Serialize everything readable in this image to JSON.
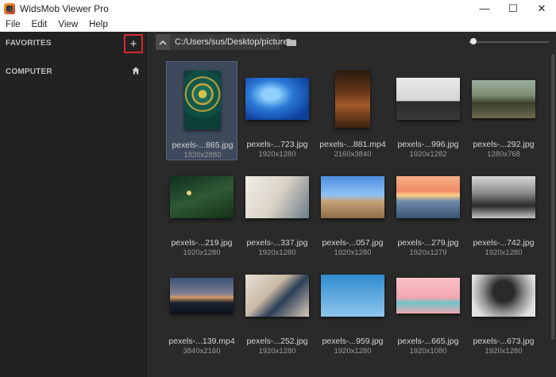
{
  "window": {
    "title": "WidsMob Viewer Pro",
    "controls": [
      "—",
      "☐",
      "✕"
    ]
  },
  "menu": [
    "File",
    "Edit",
    "View",
    "Help"
  ],
  "sidebar": {
    "favorites": "FAVORITES",
    "computer": "COMPUTER",
    "add_label": "+"
  },
  "path": {
    "text": "C:/Users/sus/Desktop/pictures"
  },
  "zoom_slider": {
    "value": 0.05
  },
  "colors": {
    "accent_red": "#d8262f",
    "selection": "#3e4a5c",
    "sidebar_bg": "#222222",
    "content_bg": "#2a2a2a"
  },
  "files": [
    {
      "name": "pexels-...865.jpg",
      "size": "1920x2880",
      "thumb": "mandala",
      "selected": true
    },
    {
      "name": "pexels-...723.jpg",
      "size": "1920x1280",
      "thumb": "water"
    },
    {
      "name": "pexels-...881.mp4",
      "size": "2160x3840",
      "thumb": "horse"
    },
    {
      "name": "pexels-...996.jpg",
      "size": "1920x1282",
      "thumb": "desk"
    },
    {
      "name": "pexels-...292.jpg",
      "size": "1280x768",
      "thumb": "rhino"
    },
    {
      "name": "pexels-...219.jpg",
      "size": "1920x1280",
      "thumb": "tree"
    },
    {
      "name": "pexels-...337.jpg",
      "size": "1920x1280",
      "thumb": "coffee"
    },
    {
      "name": "pexels-...057.jpg",
      "size": "1920x1280",
      "thumb": "ruins"
    },
    {
      "name": "pexels-...279.jpg",
      "size": "1920x1279",
      "thumb": "sunset"
    },
    {
      "name": "pexels-...742.jpg",
      "size": "1920x1280",
      "thumb": "surf"
    },
    {
      "name": "pexels-...139.mp4",
      "size": "3840x2160",
      "thumb": "dusk"
    },
    {
      "name": "pexels-...252.jpg",
      "size": "1920x1280",
      "thumb": "phone"
    },
    {
      "name": "pexels-...959.jpg",
      "size": "1920x1280",
      "thumb": "plane"
    },
    {
      "name": "pexels-...665.jpg",
      "size": "1920x1080",
      "thumb": "arch"
    },
    {
      "name": "pexels-...673.jpg",
      "size": "1920x1280",
      "thumb": "mono"
    }
  ]
}
